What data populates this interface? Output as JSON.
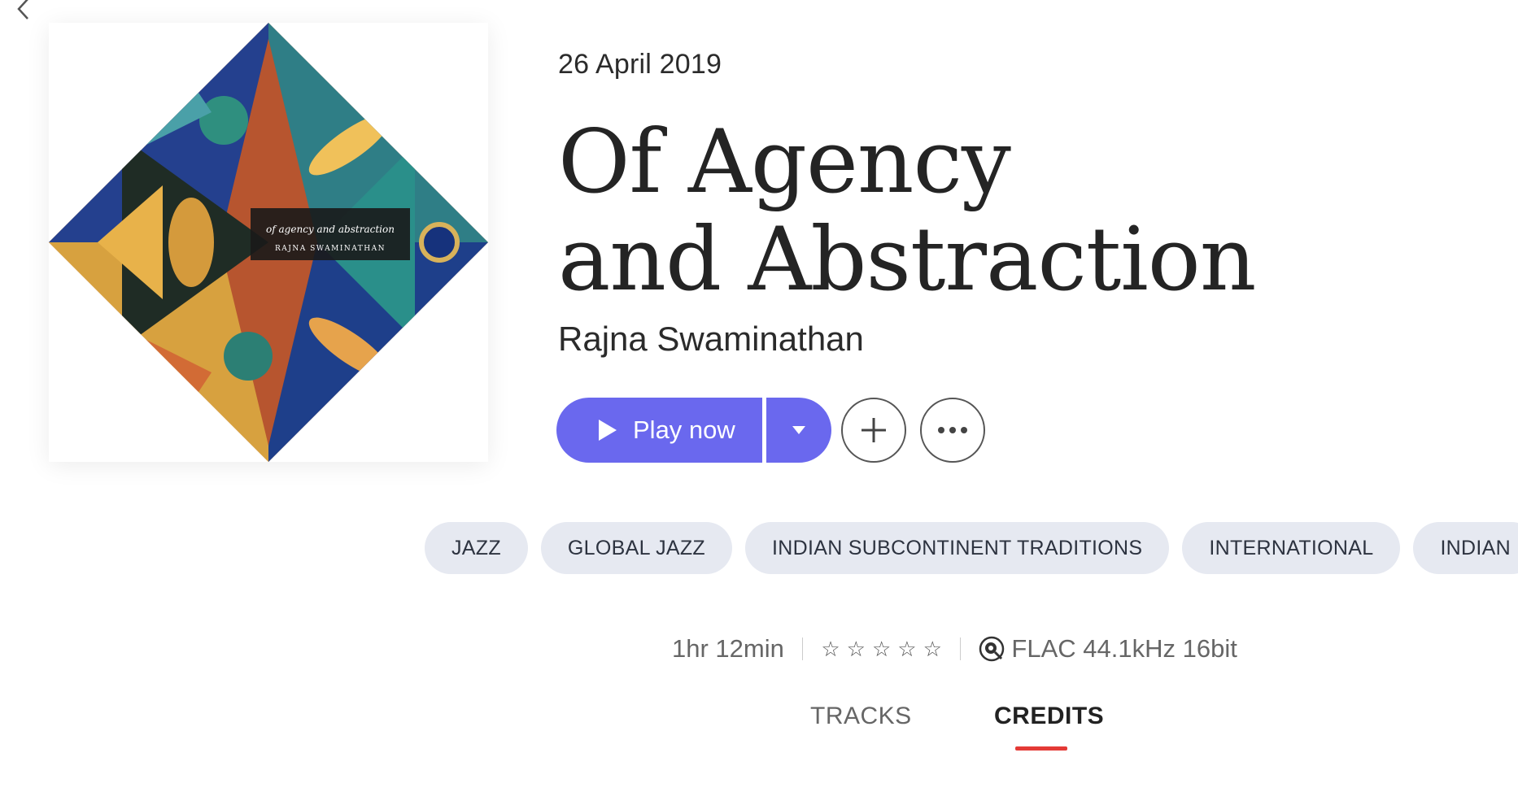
{
  "nav": {
    "back_icon": "chevron-left-icon"
  },
  "album": {
    "cover_title": "of agency and abstraction",
    "cover_artist": "RAJNA SWAMINATHAN",
    "release_date": "26 April 2019",
    "title_line1": "Of Agency",
    "title_line2": "and Abstraction",
    "artist": "Rajna Swaminathan"
  },
  "actions": {
    "play_label": "Play now",
    "play_icon": "play-icon",
    "dropdown_icon": "caret-down-icon",
    "add_icon": "plus-icon",
    "more_icon": "more-dots-icon",
    "accent_color": "#6a68ee"
  },
  "tags": [
    "JAZZ",
    "GLOBAL JAZZ",
    "INDIAN SUBCONTINENT TRADITIONS",
    "INTERNATIONAL",
    "INDIAN"
  ],
  "meta": {
    "duration": "1hr 12min",
    "rating_stars": 5,
    "rating_filled": 0,
    "quality_icon": "hi-res-badge-icon",
    "quality": "FLAC 44.1kHz 16bit"
  },
  "tabs": [
    {
      "label": "TRACKS",
      "active": false
    },
    {
      "label": "CREDITS",
      "active": true
    }
  ],
  "colors": {
    "tab_underline": "#e43a36",
    "tag_bg": "#e6e9f1"
  }
}
